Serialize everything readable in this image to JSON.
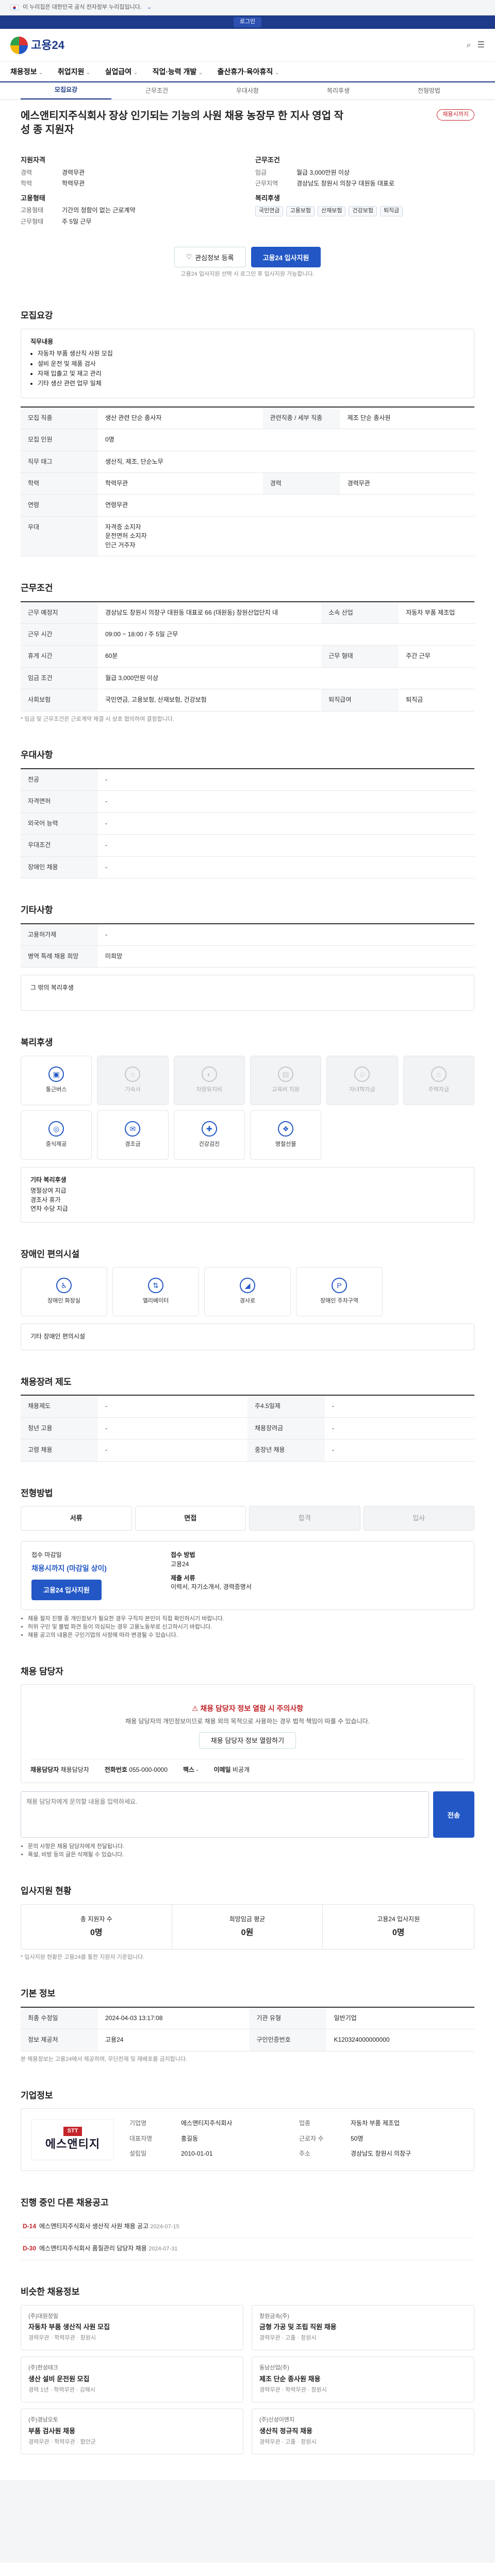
{
  "banner": {
    "text": "이 누리집은 대한민국 공식 전자정부 누리집입니다.",
    "toggle": "⌄"
  },
  "login": "로그인",
  "logo": {
    "main": "고용24",
    "sub": ""
  },
  "header_icons": [
    "search-icon",
    "menu-icon"
  ],
  "gnb": [
    "채용정보",
    "취업지원",
    "실업급여",
    "직업·능력 개발",
    "출산휴가·육아휴직"
  ],
  "tabs": [
    "모집요강",
    "근무조건",
    "우대사항",
    "복리후생",
    "전형방법"
  ],
  "job": {
    "title": "에스앤티지주식회사 장상 인기되는 기능의 사원 채용 농장무 한 지사 영업 작성 종 지원자",
    "badge": "채용시까지"
  },
  "summary": {
    "left_title": "지원자격",
    "left": [
      {
        "k": "경력",
        "v": "경력무관"
      },
      {
        "k": "학력",
        "v": "학력무관"
      }
    ],
    "left_title2": "고용형태",
    "left2": [
      {
        "k": "고용형태",
        "v": "기간의 정함이 없는 근로계약"
      },
      {
        "k": "근무형태",
        "v": "주 5일 근무"
      }
    ],
    "right_title": "근무조건",
    "right": [
      {
        "k": "임금",
        "v": "월급 3,000만원 이상"
      },
      {
        "k": "근무지역",
        "v": "경상남도 창원시 의창구 대원동 대표로"
      }
    ],
    "right_title2": "복리후생",
    "chips": [
      "국민연금",
      "고용보험",
      "산재보험",
      "건강보험",
      "퇴직금"
    ]
  },
  "cta": {
    "save": "관심정보 등록",
    "apply": "고용24 입사지원"
  },
  "cta_note": "고용24 입사지원 선택 시 로그인 후 입사지원 가능합니다.",
  "recruit": {
    "heading": "모집요강",
    "duty_title": "직무내용",
    "duties": [
      "자동차 부품 생산직 사원 모집",
      "설비 운전 및 제품 검사",
      "자재 입출고 및 재고 관리",
      "기타 생산 관련 업무 일체"
    ],
    "rows": [
      {
        "k": "모집 직종",
        "v": "생산 관련 단순 종사자",
        "k2": "관련직종 / 세부 직종",
        "v2": "제조 단순 종사원"
      },
      {
        "k": "모집 인원",
        "v": "0명",
        "k2": "",
        "v2": ""
      },
      {
        "k": "직무 태그",
        "v": "생산직, 제조, 단순노무",
        "k2": "",
        "v2": ""
      }
    ],
    "edu_k": "학력",
    "edu_v": "학력무관",
    "career_k": "경력",
    "career_v": "경력무관",
    "age_k": "연령",
    "age_v": "연령무관",
    "prefer_k": "우대",
    "prefer_v": [
      "자격증 소지자",
      "운전면허 소지자",
      "인근 거주자"
    ]
  },
  "work": {
    "heading": "근무조건",
    "rows": [
      {
        "k": "근무 예정지",
        "v": "경상남도 창원시 의창구 대원동 대표로 66 (대원동) 창원산업단지 내",
        "k2": "소속 산업",
        "v2": "자동차 부품 제조업"
      },
      {
        "k": "근무 시간",
        "v": "09:00 ~ 18:00 / 주 5일 근무",
        "k2": "",
        "v2": ""
      },
      {
        "k": "휴게 시간",
        "v": "60분",
        "k2": "근무 형태",
        "v2": "주간 근무"
      },
      {
        "k": "임금 조건",
        "v": "월급 3,000만원 이상",
        "k2": "",
        "v2": ""
      },
      {
        "k": "사회보험",
        "v": "국민연금, 고용보험, 산재보험, 건강보험",
        "k2": "퇴직급여",
        "v2": "퇴직금"
      }
    ],
    "footnote": "* 임금 및 근무조건은 근로계약 체결 시 상호 협의하여 결정합니다."
  },
  "prefer": {
    "heading": "우대사항",
    "rows": [
      {
        "k": "전공",
        "v": "-"
      },
      {
        "k": "자격면허",
        "v": "-"
      },
      {
        "k": "외국어 능력",
        "v": "-"
      },
      {
        "k": "우대조건",
        "v": "-"
      },
      {
        "k": "장애인 채용",
        "v": "-"
      }
    ]
  },
  "special": {
    "heading": "기타사항",
    "rows": [
      {
        "k": "고용허가제",
        "v": "-"
      },
      {
        "k": "병역 특례 채용 희망",
        "v": "미희망"
      }
    ],
    "free_text": "그 밖의 복리후생"
  },
  "welfare": {
    "heading": "복리후생",
    "items": [
      {
        "name": "통근버스",
        "icon": "bus-icon",
        "on": true
      },
      {
        "name": "기숙사",
        "icon": "home-icon",
        "on": false
      },
      {
        "name": "차량유지비",
        "icon": "car-icon",
        "on": false
      },
      {
        "name": "교육비 지원",
        "icon": "book-icon",
        "on": false
      },
      {
        "name": "자녀학자금",
        "icon": "child-icon",
        "on": false
      },
      {
        "name": "주택자금",
        "icon": "house-icon",
        "on": false
      },
      {
        "name": "중식제공",
        "icon": "meal-icon",
        "on": true
      },
      {
        "name": "경조금",
        "icon": "gift-icon",
        "on": true
      },
      {
        "name": "건강검진",
        "icon": "health-icon",
        "on": true
      },
      {
        "name": "명절선물",
        "icon": "present-icon",
        "on": true
      }
    ],
    "etc_title": "기타 복리후생",
    "etc_lines": [
      "명절상여 지급",
      "경조사 휴가",
      "연차 수당 지급"
    ]
  },
  "disabled": {
    "heading": "장애인 편의시설",
    "items": [
      "장애인 화장실",
      "엘리베이터",
      "경사로",
      "장애인 주차구역"
    ],
    "etc": "기타 장애인 편의시설"
  },
  "benefit": {
    "heading": "채용장려 제도",
    "rows": [
      {
        "k": "채용제도",
        "v": "-",
        "k2": "주4.5일제",
        "v2": "-"
      },
      {
        "k": "청년 고용",
        "v": "-",
        "k2": "채용장려금",
        "v2": "-"
      },
      {
        "k": "고령 채용",
        "v": "-",
        "k2": "중장년 채용",
        "v2": "-"
      }
    ]
  },
  "process": {
    "heading": "전형방법",
    "steps": [
      "서류",
      "면접",
      "합격",
      "입사"
    ],
    "apply_title": "접수 마감일",
    "apply_date": "채용시까지 (마감일 상이)",
    "apply_btn": "고용24 입사지원",
    "method_title": "접수 방법",
    "method_v": "고용24",
    "docs_title": "제출 서류",
    "docs_v": "이력서, 자기소개서, 경력증명서",
    "warns": [
      "채용 절차 진행 중 개인정보가 필요한 경우 구직자 본인이 직접 확인하시기 바랍니다.",
      "허위 구인 및 불법 파견 등이 의심되는 경우 고용노동부로 신고하시기 바랍니다.",
      "채용 공고의 내용은 구인기업의 사정에 따라 변경될 수 있습니다."
    ]
  },
  "contact": {
    "heading": "채용 담당자",
    "lead": "채용 담당자 정보 열람 시 주의사항",
    "desc": "채용 담당자의 개인정보이므로 채용 외의 목적으로 사용하는 경우 법적 책임이 따를 수 있습니다.",
    "btn": "채용 담당자 정보 열람하기",
    "name_k": "채용담당자",
    "name_v": "채용담당자",
    "phone_k": "전화번호",
    "phone_v": "055-000-0000",
    "fax_k": "팩스",
    "fax_v": "-",
    "email_k": "이메일",
    "email_v": "비공개",
    "qa_placeholder": "채용 담당자에게 문의할 내용을 입력하세요.",
    "qa_btn": "전송",
    "qa_notes": [
      "문의 사항은 채용 담당자에게 전달됩니다.",
      "욕설, 비방 등의 글은 삭제될 수 있습니다."
    ]
  },
  "stats": {
    "heading": "입사지원 현황",
    "cards": [
      {
        "k": "총 지원자 수",
        "v": "0명"
      },
      {
        "k": "희망임금 평균",
        "v": "0원"
      },
      {
        "k": "고용24 입사지원",
        "v": "0명"
      }
    ],
    "note": "* 입사지원 현황은 고용24를 통한 지원자 기준입니다."
  },
  "meta": {
    "heading": "기본 정보",
    "rows": [
      {
        "k": "최종 수정일",
        "v": "2024-04-03 13:17:08",
        "k2": "기관 유형",
        "v2": "일반기업"
      },
      {
        "k": "정보 제공처",
        "v": "고용24",
        "k2": "구인인증번호",
        "v2": "K120324000000000"
      }
    ],
    "note": "본 채용정보는 고용24에서 제공하며, 무단전재 및 재배포를 금지합니다."
  },
  "company": {
    "heading": "기업정보",
    "brand_top": "STT",
    "brand": "에스앤티지",
    "info": [
      {
        "k": "기업명",
        "v": "에스앤티지주식회사"
      },
      {
        "k": "업종",
        "v": "자동차 부품 제조업"
      },
      {
        "k": "대표자명",
        "v": "홍길동"
      },
      {
        "k": "근로자 수",
        "v": "50명"
      },
      {
        "k": "설립일",
        "v": "2010-01-01"
      },
      {
        "k": "주소",
        "v": "경상남도 창원시 의창구"
      }
    ]
  },
  "ongoing": {
    "heading": "진행 중인 다른 채용공고",
    "items": [
      {
        "d": "D-14",
        "title": "에스앤티지주식회사 생산직 사원 채용 공고",
        "date": "2024-07-15"
      },
      {
        "d": "D-30",
        "title": "에스앤티지주식회사 품질관리 담당자 채용",
        "date": "2024-07-31"
      }
    ]
  },
  "similar": {
    "heading": "비슷한 채용정보",
    "cards": [
      {
        "nm": "(주)대원정밀",
        "tt": "자동차 부품 생산직 사원 모집",
        "meta": "경력무관 · 학력무관 · 창원시"
      },
      {
        "nm": "창원금속(주)",
        "tt": "금형 가공 및 조립 직원 채용",
        "meta": "경력무관 · 고졸 · 창원시"
      },
      {
        "nm": "(주)한성테크",
        "tt": "생산 설비 운전원 모집",
        "meta": "경력 1년 · 학력무관 · 김해시"
      },
      {
        "nm": "동남산업(주)",
        "tt": "제조 단순 종사원 채용",
        "meta": "경력무관 · 학력무관 · 창원시"
      },
      {
        "nm": "(주)경남오토",
        "tt": "부품 검사원 채용",
        "meta": "경력무관 · 학력무관 · 함안군"
      },
      {
        "nm": "(주)신성이엔지",
        "tt": "생산직 정규직 채용",
        "meta": "경력무관 · 고졸 · 창원시"
      }
    ]
  }
}
